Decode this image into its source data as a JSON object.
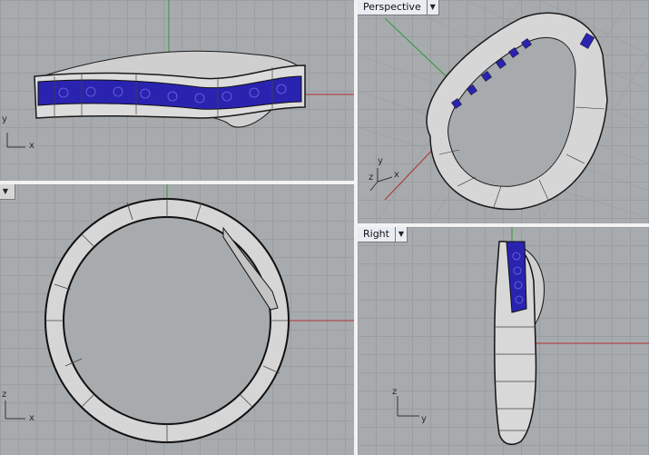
{
  "viewports": {
    "top_left": {
      "axis_y": "y",
      "axis_x": "x"
    },
    "perspective": {
      "tab_label": "Perspective",
      "axis_y": "y",
      "axis_x": "x",
      "axis_z": "z"
    },
    "bottom_left": {
      "axis_z": "z",
      "axis_x": "x"
    },
    "right": {
      "tab_label": "Right",
      "axis_z": "z",
      "axis_y": "y"
    }
  },
  "colors": {
    "viewport_bg": "#a8abae",
    "grid_line": "#9b9ea1",
    "axis_red": "#b03030",
    "axis_green": "#2f9a3a",
    "ring_metal": "#d9d9d9",
    "gem_blue": "#2a23b0",
    "wire_edge": "#1a1a1a"
  }
}
